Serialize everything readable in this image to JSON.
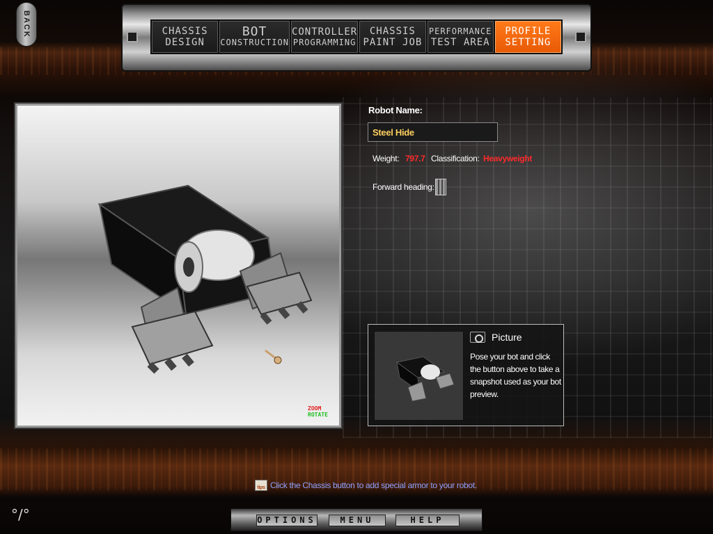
{
  "back_button": {
    "label": "BACK"
  },
  "nav_tabs": [
    {
      "line1": "CHASSIS",
      "line2": "DESIGN"
    },
    {
      "line1": "BOT",
      "line2": "CONSTRUCTION"
    },
    {
      "line1": "CONTROLLER",
      "line2": "PROGRAMMING"
    },
    {
      "line1": "CHASSIS",
      "line2": "PAINT JOB"
    },
    {
      "line1": "PERFORMANCE",
      "line2": "TEST AREA"
    },
    {
      "line1": "PROFILE",
      "line2": "SETTING",
      "active": true
    }
  ],
  "viewport": {
    "zoom_label": "ZOOM",
    "rotate_label": "ROTATE"
  },
  "profile": {
    "name_label": "Robot Name:",
    "name_value": "Steel Hide",
    "weight_label": "Weight:",
    "weight_value": "797.7",
    "class_label": "Classification:",
    "class_value": "Heavyweight",
    "heading_label": "Forward heading:"
  },
  "picture_panel": {
    "title": "Picture",
    "icon": "camera-icon",
    "description": "Pose your bot and click the button above to take a snapshot used as your bot preview."
  },
  "hint": {
    "icon": "tips-icon",
    "icon_text": "tips",
    "text": "Click the Chassis button to add special armor to your robot."
  },
  "bottom_menu": {
    "options": "OPTIONS",
    "menu": "MENU",
    "help": "HELP"
  },
  "status_glyph": "°/°",
  "colors": {
    "accent_orange": "#ff7a1a",
    "value_red": "#ff2a2a",
    "name_yellow": "#ffd060",
    "hint_blue": "#8fa0ff"
  }
}
